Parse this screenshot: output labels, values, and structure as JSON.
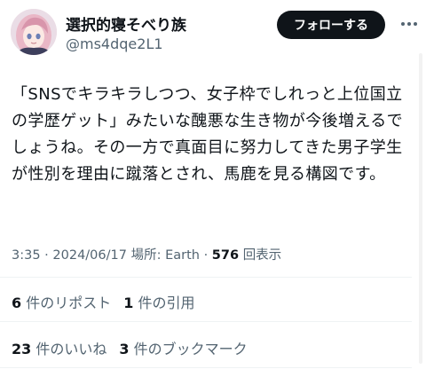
{
  "user": {
    "display_name": "選択的寝そべり族",
    "handle": "@ms4dqe2L1",
    "avatar_icon": "anime-avatar-icon"
  },
  "header": {
    "follow_label": "フォローする",
    "more_icon": "ellipsis-icon"
  },
  "tweet": {
    "text": "「SNSでキラキラしつつ、女子枠でしれっと上位国立の学歴ゲット」みたいな醜悪な生き物が今後増えるでしょうね。その一方で真面目に努力してきた男子学生が性別を理由に蹴落とされ、馬鹿を見る構図です。"
  },
  "meta": {
    "time": "3:35",
    "separator": " · ",
    "date": "2024/06/17",
    "location": "場所: Earth",
    "views_count": "576",
    "views_label": "回表示"
  },
  "stats": {
    "reposts_count": "6",
    "reposts_label": "件のリポスト",
    "quotes_count": "1",
    "quotes_label": "件の引用",
    "likes_count": "23",
    "likes_label": "件のいいね",
    "bookmarks_count": "3",
    "bookmarks_label": "件のブックマーク"
  },
  "colors": {
    "text": "#0f1419",
    "secondary_text": "#536471",
    "divider": "#eff3f4",
    "button_bg": "#0f1419"
  }
}
